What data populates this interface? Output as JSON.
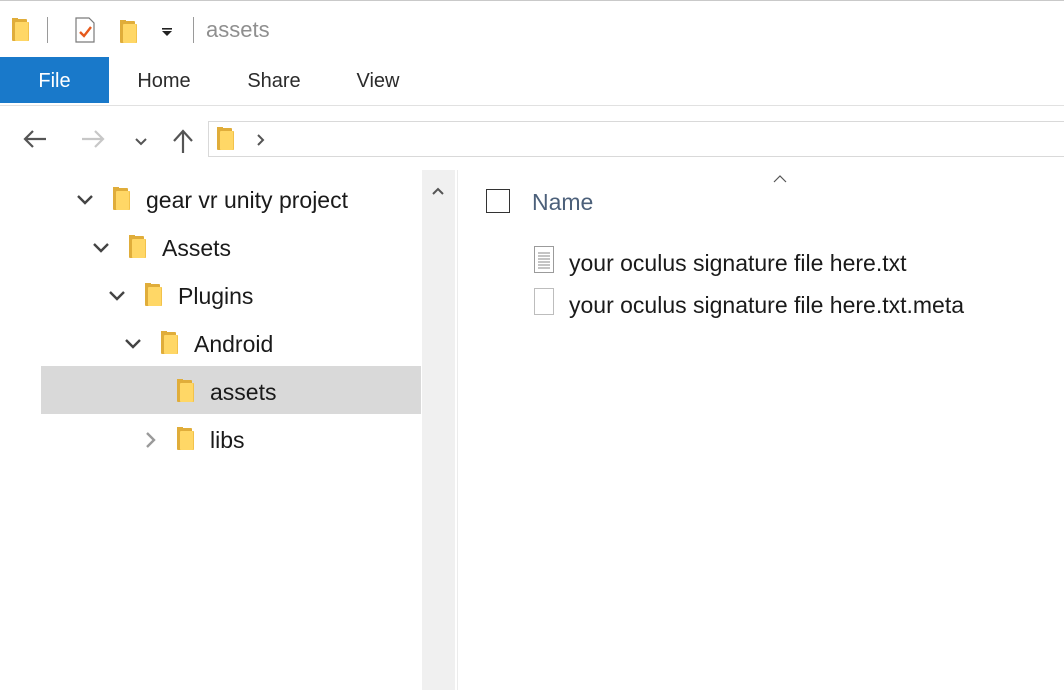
{
  "window": {
    "title": "assets"
  },
  "ribbon": {
    "tabs": [
      "File",
      "Home",
      "Share",
      "View"
    ],
    "active": "File",
    "accent": "#1979ca"
  },
  "nav": {
    "back": "back-icon",
    "forward": "forward-icon",
    "recent": "chevron-down-icon",
    "up": "up-arrow-icon"
  },
  "tree": {
    "items": [
      {
        "label": "gear vr unity project",
        "expanded": true
      },
      {
        "label": "Assets",
        "expanded": true
      },
      {
        "label": "Plugins",
        "expanded": true
      },
      {
        "label": "Android",
        "expanded": true
      },
      {
        "label": "assets",
        "selected": true
      },
      {
        "label": "libs",
        "expanded": false
      }
    ]
  },
  "content": {
    "column_name": "Name",
    "files": [
      {
        "name": "your oculus signature file here.txt",
        "icon": "text-file-icon"
      },
      {
        "name": "your oculus signature file here.txt.meta",
        "icon": "blank-file-icon"
      }
    ]
  }
}
